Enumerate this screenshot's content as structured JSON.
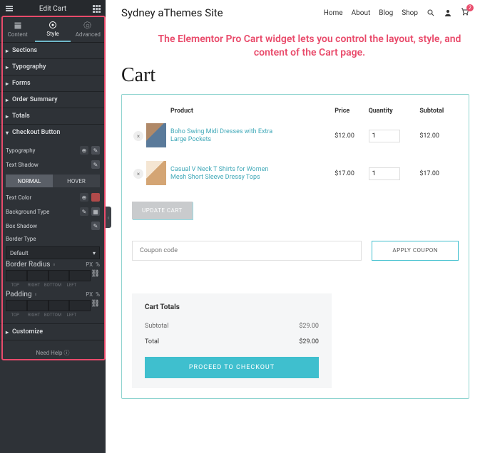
{
  "sidebar": {
    "title": "Edit Cart",
    "tabs": {
      "content": "Content",
      "style": "Style",
      "advanced": "Advanced"
    },
    "sections": {
      "sections": "Sections",
      "typography": "Typography",
      "forms": "Forms",
      "order_summary": "Order Summary",
      "totals": "Totals",
      "checkout_button": "Checkout Button",
      "customize": "Customize"
    },
    "checkout": {
      "typography": "Typography",
      "text_shadow": "Text Shadow",
      "normal": "NORMAL",
      "hover": "HOVER",
      "text_color": "Text Color",
      "background_type": "Background Type",
      "box_shadow": "Box Shadow",
      "border_type": "Border Type",
      "border_type_value": "Default",
      "border_radius": "Border Radius",
      "padding": "Padding",
      "unit": "PX",
      "pct": "%",
      "dim": {
        "top": "TOP",
        "right": "RIGHT",
        "bottom": "BOTTOM",
        "left": "LEFT"
      }
    },
    "help": "Need Help"
  },
  "site": {
    "title": "Sydney aThemes Site",
    "nav": {
      "home": "Home",
      "about": "About",
      "blog": "Blog",
      "shop": "Shop"
    },
    "cart_count": "2"
  },
  "annotation": "The Elementor Pro Cart widget lets you control the layout, style, and content of the Cart page.",
  "page_heading": "Cart",
  "table": {
    "headers": {
      "product": "Product",
      "price": "Price",
      "quantity": "Quantity",
      "subtotal": "Subtotal"
    },
    "rows": [
      {
        "name": "Boho Swing Midi Dresses with Extra Large Pockets",
        "price": "$12.00",
        "qty": "1",
        "subtotal": "$12.00"
      },
      {
        "name": "Casual V Neck T Shirts for Women Mesh Short Sleeve Dressy Tops",
        "price": "$17.00",
        "qty": "1",
        "subtotal": "$17.00"
      }
    ],
    "update": "UPDATE CART"
  },
  "coupon": {
    "placeholder": "Coupon code",
    "apply": "APPLY COUPON"
  },
  "totals_box": {
    "title": "Cart Totals",
    "subtotal_label": "Subtotal",
    "subtotal": "$29.00",
    "total_label": "Total",
    "total": "$29.00",
    "checkout": "PROCEED TO CHECKOUT"
  }
}
